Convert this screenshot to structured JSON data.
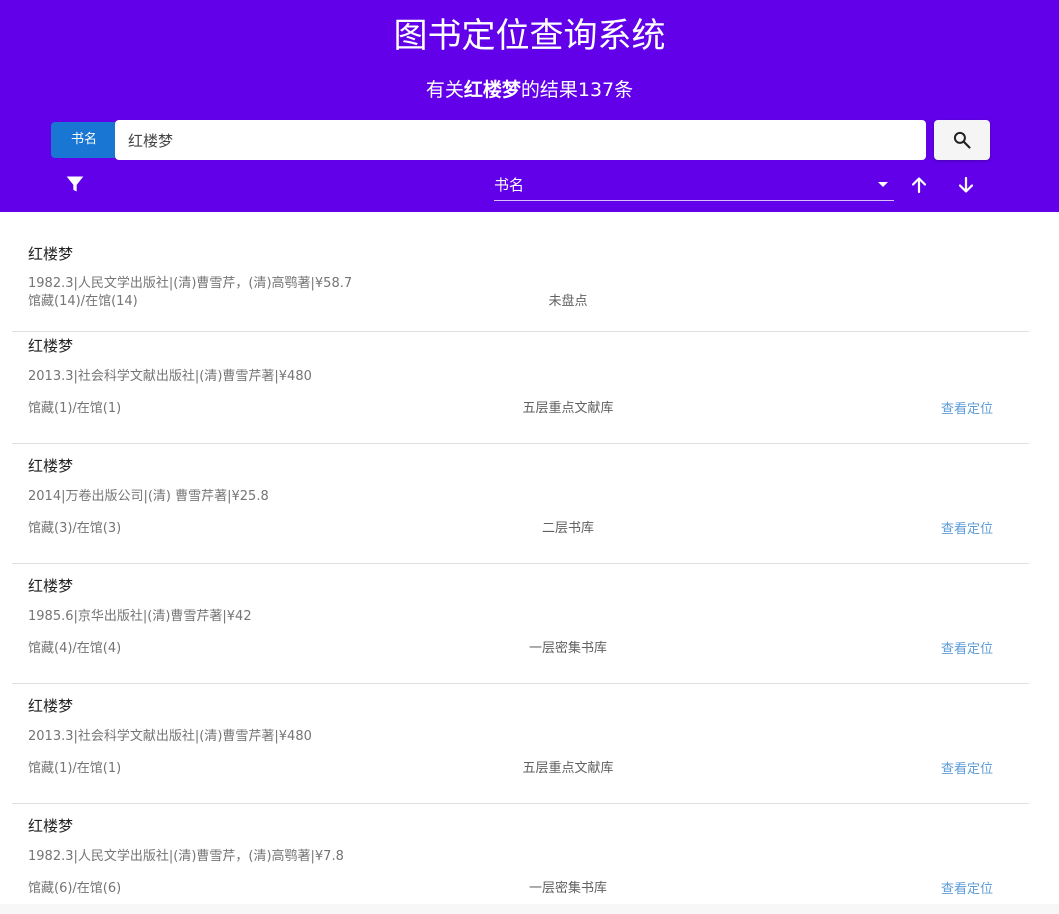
{
  "header": {
    "title": "图书定位查询系统",
    "result_prefix": "有关",
    "result_query": "红楼梦",
    "result_suffix": "的结果137条",
    "background_color": "#6200ea"
  },
  "search": {
    "field_type": "书名",
    "value": "红楼梦",
    "button_icon": "search-icon"
  },
  "toolbar": {
    "filter_icon": "filter-icon",
    "sort_field": "书名",
    "sort_asc_icon": "arrow-up-icon",
    "sort_desc_icon": "arrow-down-icon"
  },
  "results": [
    {
      "title": "红楼梦",
      "meta": "1982.3|人民文学出版社|(清)曹雪芹，(清)高鹗著|¥58.7",
      "holdings": "馆藏(14)/在馆(14)",
      "location": "未盘点",
      "action": ""
    },
    {
      "title": "红楼梦",
      "meta": "2013.3|社会科学文献出版社|(清)曹雪芹著|¥480",
      "holdings": "馆藏(1)/在馆(1)",
      "location": "五层重点文献库",
      "action": "查看定位"
    },
    {
      "title": "红楼梦",
      "meta": "2014|万卷出版公司|(清) 曹雪芹著|¥25.8",
      "holdings": "馆藏(3)/在馆(3)",
      "location": "二层书库",
      "action": "查看定位"
    },
    {
      "title": "红楼梦",
      "meta": "1985.6|京华出版社|(清)曹雪芹著|¥42",
      "holdings": "馆藏(4)/在馆(4)",
      "location": "一层密集书库",
      "action": "查看定位"
    },
    {
      "title": "红楼梦",
      "meta": "2013.3|社会科学文献出版社|(清)曹雪芹著|¥480",
      "holdings": "馆藏(1)/在馆(1)",
      "location": "五层重点文献库",
      "action": "查看定位"
    },
    {
      "title": "红楼梦",
      "meta": "1982.3|人民文学出版社|(清)曹雪芹，(清)高鹗著|¥7.8",
      "holdings": "馆藏(6)/在馆(6)",
      "location": "一层密集书库",
      "action": "查看定位"
    }
  ]
}
